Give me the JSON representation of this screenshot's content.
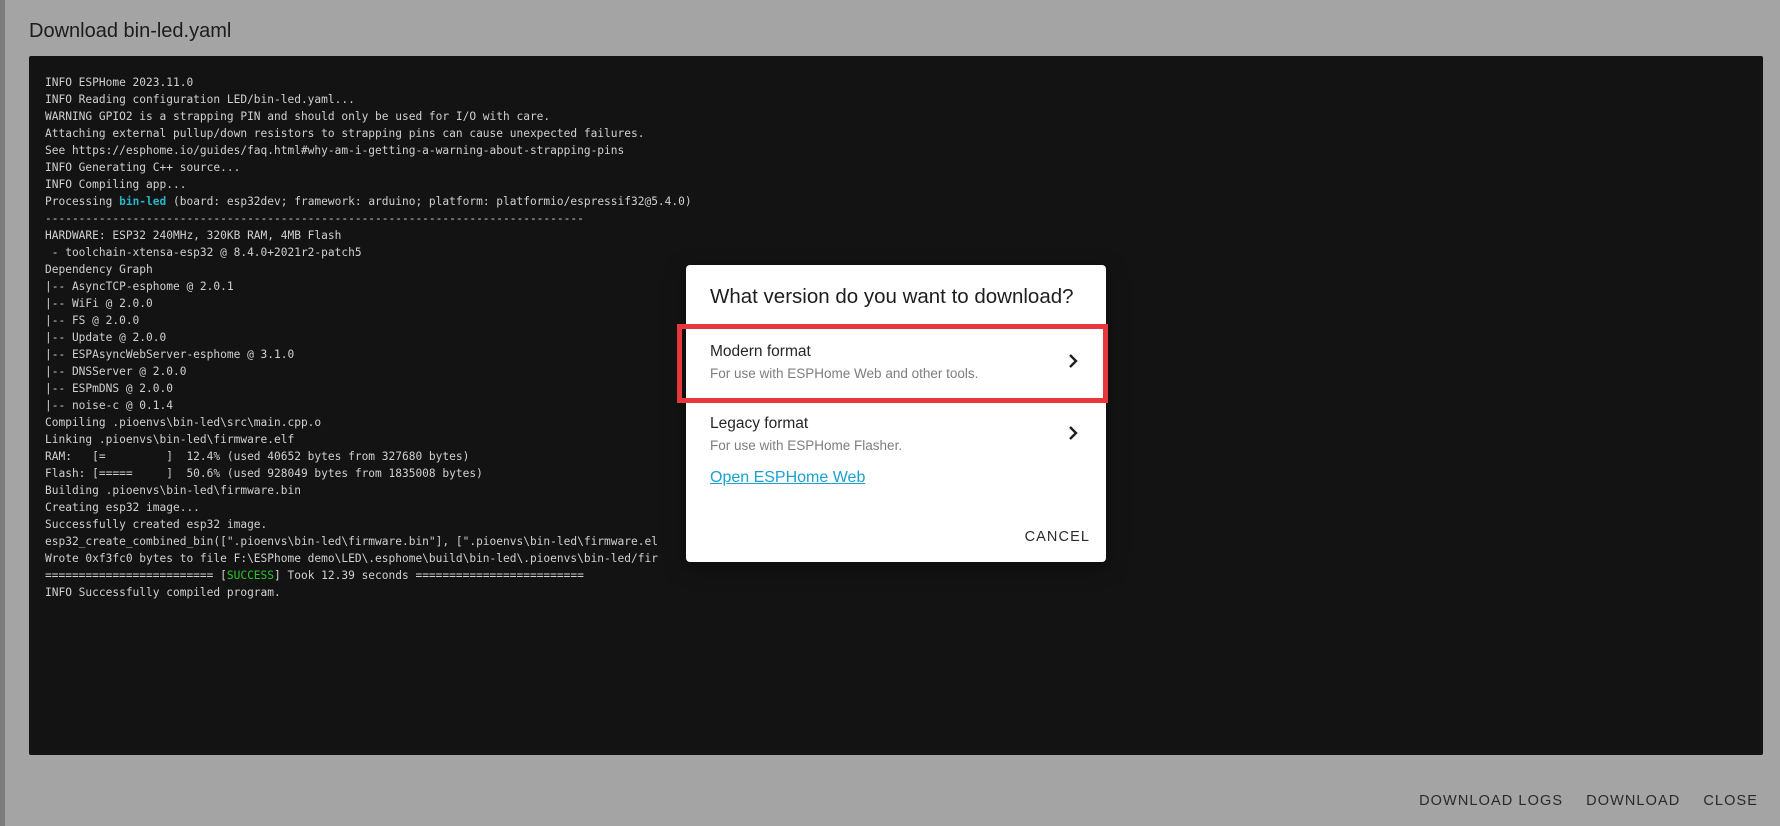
{
  "page": {
    "title": "Download bin-led.yaml"
  },
  "console": {
    "lines": [
      [
        {
          "t": "INFO ESPHome 2023.11.0"
        }
      ],
      [
        {
          "t": "INFO Reading configuration LED/bin-led.yaml..."
        }
      ],
      [
        {
          "t": "WARNING GPIO2 is a strapping PIN and should only be used for I/O with care."
        }
      ],
      [
        {
          "t": "Attaching external pullup/down resistors to strapping pins can cause unexpected failures."
        }
      ],
      [
        {
          "t": "See https://esphome.io/guides/faq.html#why-am-i-getting-a-warning-about-strapping-pins"
        }
      ],
      [
        {
          "t": "INFO Generating C++ source..."
        }
      ],
      [
        {
          "t": "INFO Compiling app..."
        }
      ],
      [
        {
          "t": "Processing "
        },
        {
          "t": "bin-led",
          "c": "hl-cyan"
        },
        {
          "t": " (board: esp32dev; framework: arduino; platform: platformio/espressif32@5.4.0)"
        }
      ],
      [
        {
          "t": "--------------------------------------------------------------------------------"
        }
      ],
      [
        {
          "t": "HARDWARE: ESP32 240MHz, 320KB RAM, 4MB Flash"
        }
      ],
      [
        {
          "t": " - toolchain-xtensa-esp32 @ 8.4.0+2021r2-patch5"
        }
      ],
      [
        {
          "t": "Dependency Graph"
        }
      ],
      [
        {
          "t": "|-- AsyncTCP-esphome @ 2.0.1"
        }
      ],
      [
        {
          "t": "|-- WiFi @ 2.0.0"
        }
      ],
      [
        {
          "t": "|-- FS @ 2.0.0"
        }
      ],
      [
        {
          "t": "|-- Update @ 2.0.0"
        }
      ],
      [
        {
          "t": "|-- ESPAsyncWebServer-esphome @ 3.1.0"
        }
      ],
      [
        {
          "t": "|-- DNSServer @ 2.0.0"
        }
      ],
      [
        {
          "t": "|-- ESPmDNS @ 2.0.0"
        }
      ],
      [
        {
          "t": "|-- noise-c @ 0.1.4"
        }
      ],
      [
        {
          "t": "Compiling .pioenvs\\bin-led\\src\\main.cpp.o"
        }
      ],
      [
        {
          "t": "Linking .pioenvs\\bin-led\\firmware.elf"
        }
      ],
      [
        {
          "t": "RAM:   [=         ]  12.4% (used 40652 bytes from 327680 bytes)"
        }
      ],
      [
        {
          "t": "Flash: [=====     ]  50.6% (used 928049 bytes from 1835008 bytes)"
        }
      ],
      [
        {
          "t": "Building .pioenvs\\bin-led\\firmware.bin"
        }
      ],
      [
        {
          "t": "Creating esp32 image..."
        }
      ],
      [
        {
          "t": "Successfully created esp32 image."
        }
      ],
      [
        {
          "t": "esp32_create_combined_bin([\".pioenvs\\bin-led\\firmware.bin\"], [\".pioenvs\\bin-led\\firmware.el"
        }
      ],
      [
        {
          "t": "Wrote 0xf3fc0 bytes to file F:\\ESPhome demo\\LED\\.esphome\\build\\bin-led\\.pioenvs\\bin-led/fir"
        }
      ],
      [
        {
          "t": "========================= ["
        },
        {
          "t": "SUCCESS",
          "c": "hl-green"
        },
        {
          "t": "] Took 12.39 seconds ========================="
        }
      ],
      [
        {
          "t": "INFO Successfully compiled program."
        }
      ]
    ]
  },
  "actions": {
    "download_logs": "DOWNLOAD LOGS",
    "download": "DOWNLOAD",
    "close": "CLOSE"
  },
  "modal": {
    "title": "What version do you want to download?",
    "options": [
      {
        "title": "Modern format",
        "subtitle": "For use with ESPHome Web and other tools.",
        "icon": "chevron-right-icon"
      },
      {
        "title": "Legacy format",
        "subtitle": "For use with ESPHome Flasher.",
        "icon": "chevron-right-icon"
      }
    ],
    "link": "Open ESPHome Web",
    "cancel": "CANCEL"
  },
  "colors": {
    "overlay": "#a4a4a4",
    "console_bg": "#131313",
    "highlight": "#e8373c",
    "link": "#1aa1cf",
    "success": "#28c728",
    "env_name": "#26b5c7"
  }
}
